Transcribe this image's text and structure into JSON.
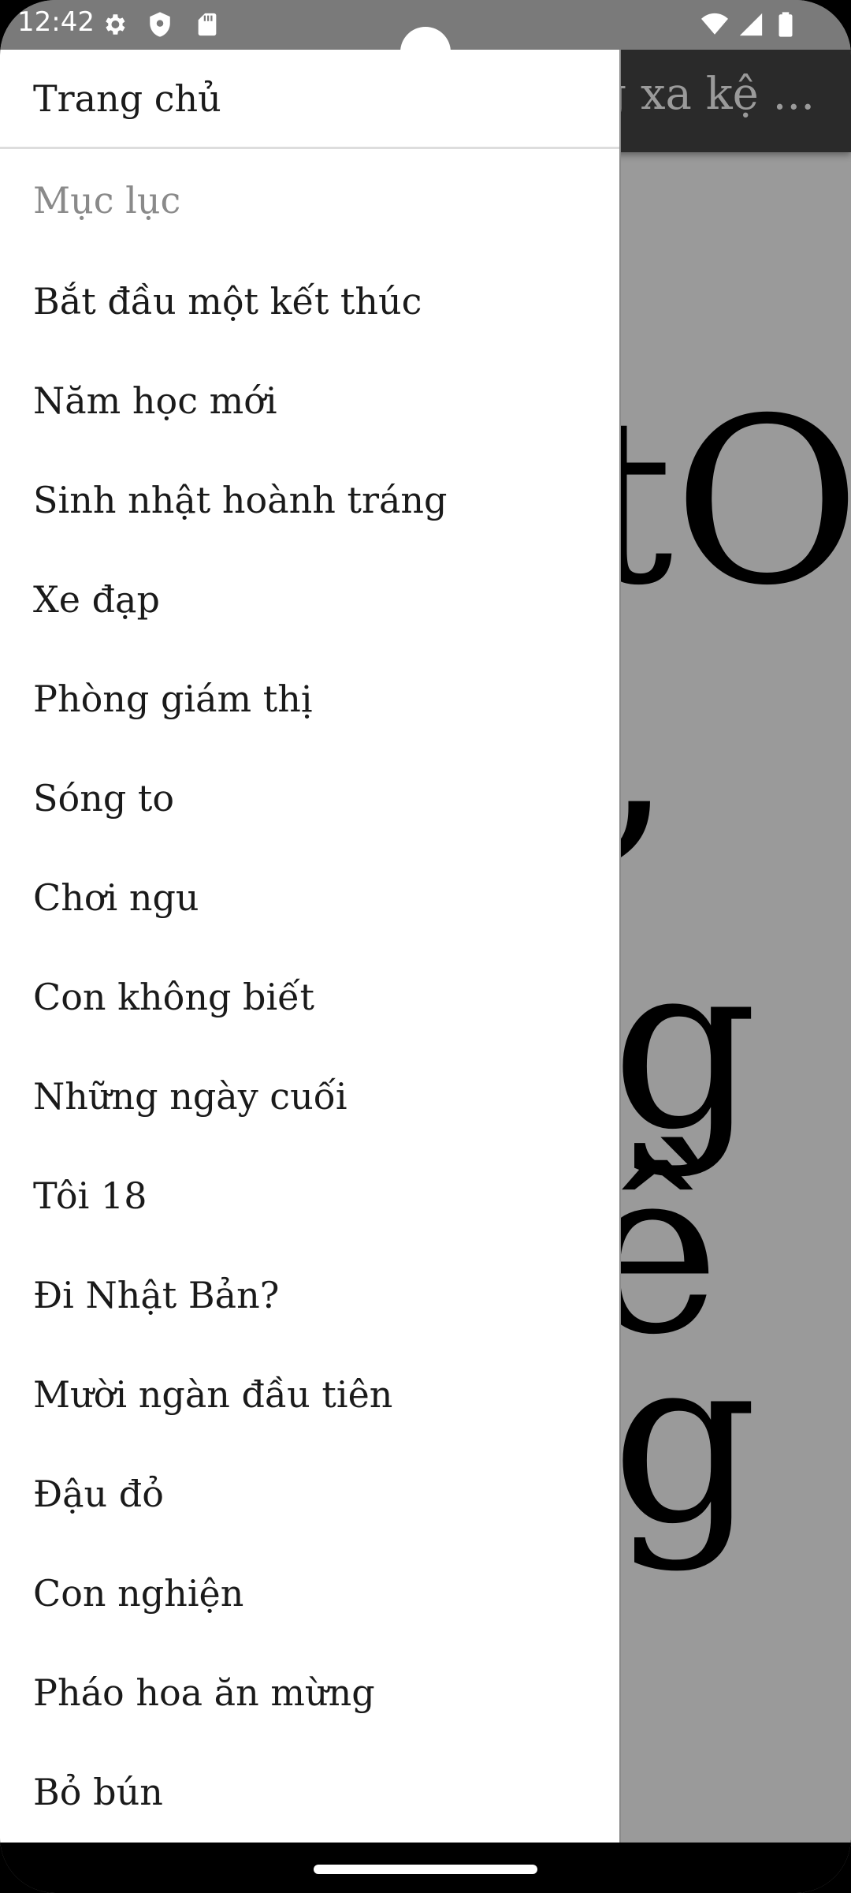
{
  "status_bar": {
    "time": "12:42",
    "icons": [
      "gear-icon",
      "shield-icon",
      "sd-card-icon",
      "wifi-icon",
      "signal-icon",
      "battery-icon"
    ]
  },
  "reader": {
    "title": "g xa kệ ...",
    "glyphs": [
      "tO",
      "’",
      "g",
      "ề",
      "g"
    ]
  },
  "drawer": {
    "home_label": "Trang chủ",
    "section_label": "Mục lục",
    "items": [
      "Bắt đầu một kết thúc",
      "Năm học mới",
      "Sinh nhật hoành tráng",
      "Xe đạp",
      "Phòng giám thị",
      "Sóng to",
      "Chơi ngu",
      "Con không biết",
      "Những ngày cuối",
      "Tôi 18",
      "Đi Nhật Bản?",
      "Mười ngàn đầu tiên",
      "Đậu đỏ",
      "Con nghiện",
      "Pháo hoa ăn mừng",
      "Bỏ bún"
    ]
  },
  "colors": {
    "status_bar": "#7a7a7a",
    "toolbar": "#2a2a2a",
    "scrim": "#9a9a9a",
    "drawer": "#ffffff",
    "section_label": "#8a8a8a"
  }
}
